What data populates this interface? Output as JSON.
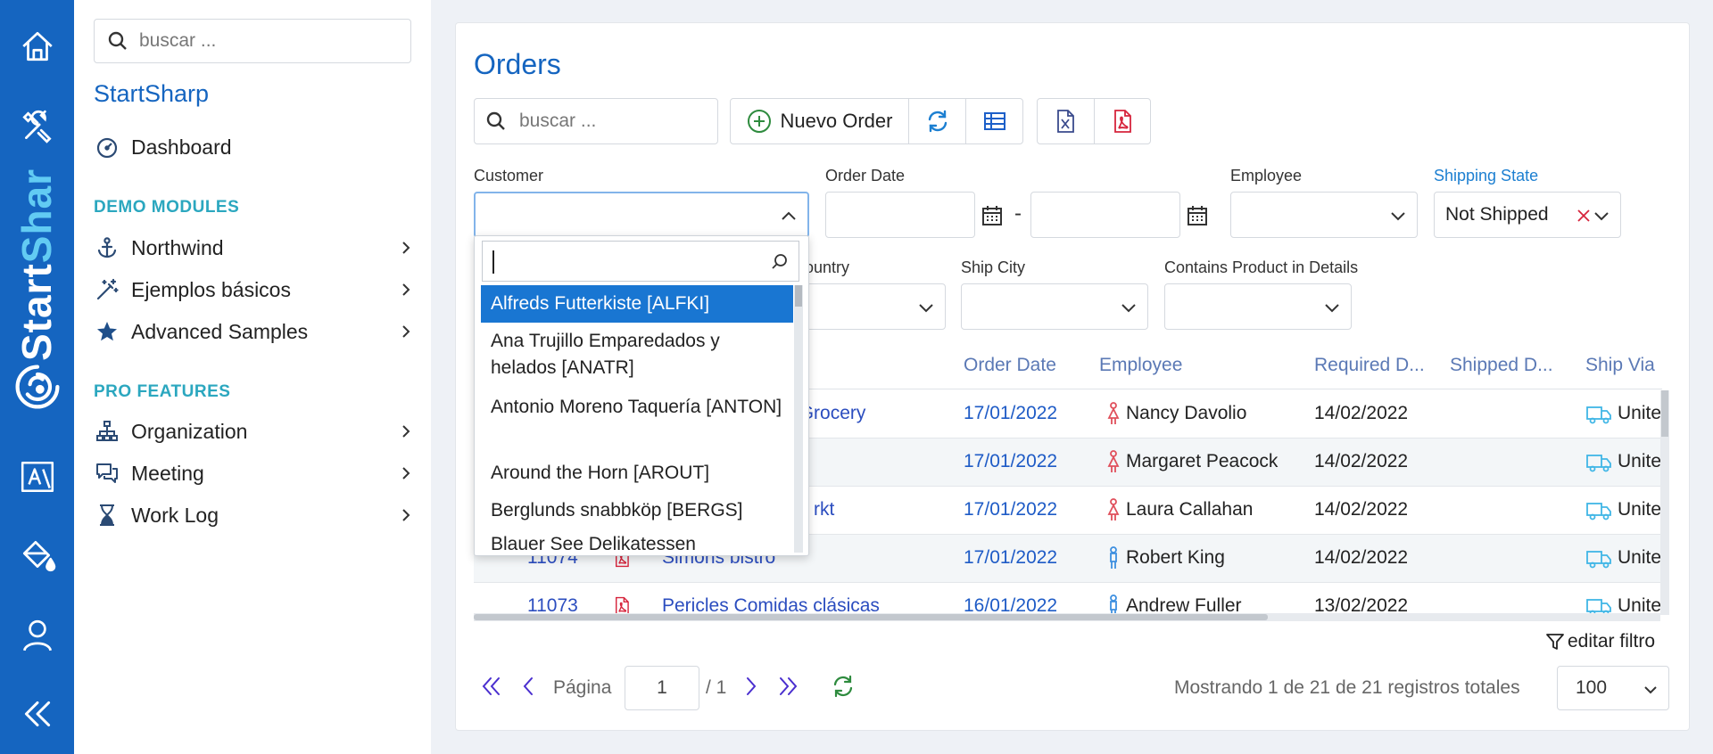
{
  "rail": {
    "brand": [
      "Start",
      "Shar"
    ]
  },
  "sidebar": {
    "search_placeholder": "buscar ...",
    "brand": "StartSharp",
    "dashboard": "Dashboard",
    "demo_modules_title": "DEMO MODULES",
    "demo_items": [
      "Northwind",
      "Ejemplos básicos",
      "Advanced Samples"
    ],
    "pro_features_title": "PRO FEATURES",
    "pro_items": [
      "Organization",
      "Meeting",
      "Work Log"
    ]
  },
  "main": {
    "title": "Orders",
    "search_placeholder": "buscar ...",
    "new_button": "Nuevo Order",
    "filters": {
      "customer": "Customer",
      "order_date": "Order Date",
      "date_separator": "-",
      "employee": "Employee",
      "shipping_state": "Shipping State",
      "shipping_state_value": "Not Shipped",
      "ship_country": "ountry",
      "ship_city": "Ship City",
      "contains_product": "Contains Product in Details"
    },
    "grid": {
      "headers": [
        "Order Date",
        "Employee",
        "Required D...",
        "Shipped D...",
        "Ship Via"
      ],
      "rows": [
        {
          "id": "",
          "customer": "von Grocery",
          "order_date": "17/01/2022",
          "employee": "Nancy Davolio",
          "emp_gender": "female",
          "required": "14/02/2022",
          "shipped": "",
          "ship_via": "Unite"
        },
        {
          "id": "",
          "customer": "",
          "order_date": "17/01/2022",
          "employee": "Margaret Peacock",
          "emp_gender": "female",
          "required": "14/02/2022",
          "shipped": "",
          "ship_via": "Unite"
        },
        {
          "id": "",
          "customer": "rkt",
          "order_date": "17/01/2022",
          "employee": "Laura Callahan",
          "emp_gender": "female",
          "required": "14/02/2022",
          "shipped": "",
          "ship_via": "Unite"
        },
        {
          "id": "11074",
          "customer": "Simons bistro",
          "order_date": "17/01/2022",
          "employee": "Robert King",
          "emp_gender": "male",
          "required": "14/02/2022",
          "shipped": "",
          "ship_via": "Unite"
        },
        {
          "id": "11073",
          "customer": "Pericles Comidas clásicas",
          "order_date": "16/01/2022",
          "employee": "Andrew Fuller",
          "emp_gender": "male",
          "required": "13/02/2022",
          "shipped": "",
          "ship_via": "Unite"
        }
      ]
    },
    "dropdown": {
      "options": [
        "Alfreds Futterkiste [ALFKI]",
        "Ana Trujillo Emparedados y helados [ANATR]",
        "Antonio Moreno Taquería [ANTON]",
        "Around the Horn [AROUT]",
        "Berglunds snabbköp [BERGS]",
        "Blauer See Delikatessen"
      ],
      "selected_index": 0
    },
    "edit_filter": "editar filtro",
    "pager": {
      "page_label": "Página",
      "page_value": "1",
      "page_total": "/ 1",
      "summary": "Mostrando 1 de 21 de 21 registros totales",
      "page_size": "100"
    }
  },
  "colors": {
    "brand_blue": "#1565c0",
    "accent_cyan": "#2ba7bf",
    "female_icon": "#e0505c",
    "male_icon": "#3d8fe0",
    "ship_icon": "#40b6e6",
    "excel_icon": "#3a4a8c",
    "pdf_icon": "#d6243c",
    "refresh_icon": "#1c7fd1",
    "add_icon": "#2e8b3e"
  }
}
